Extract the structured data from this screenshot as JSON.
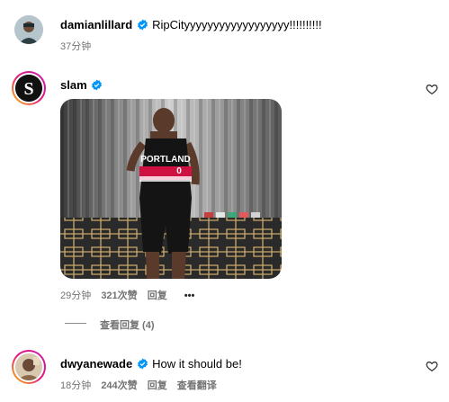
{
  "comments": [
    {
      "username": "damianlillard",
      "text": "RipCityyyyyyyyyyyyyyyyyy!!!!!!!!!!",
      "time": "37分钟"
    },
    {
      "username": "slam",
      "time": "29分钟",
      "likes": "321次赞",
      "reply": "回复",
      "more": "•••",
      "jersey_text": "PORTLAND",
      "jersey_number": "0",
      "view_replies": "查看回复 (4)"
    },
    {
      "username": "dwyanewade",
      "text": "How it should be!",
      "time": "18分钟",
      "likes": "244次赞",
      "reply": "回复",
      "translate": "查看翻译"
    }
  ],
  "icons": {
    "verified": "verified-badge-icon",
    "like": "heart-outline-icon"
  },
  "colors": {
    "verified_blue": "#0095f6",
    "muted_text": "#737373",
    "jersey_red": "#ce1141"
  }
}
